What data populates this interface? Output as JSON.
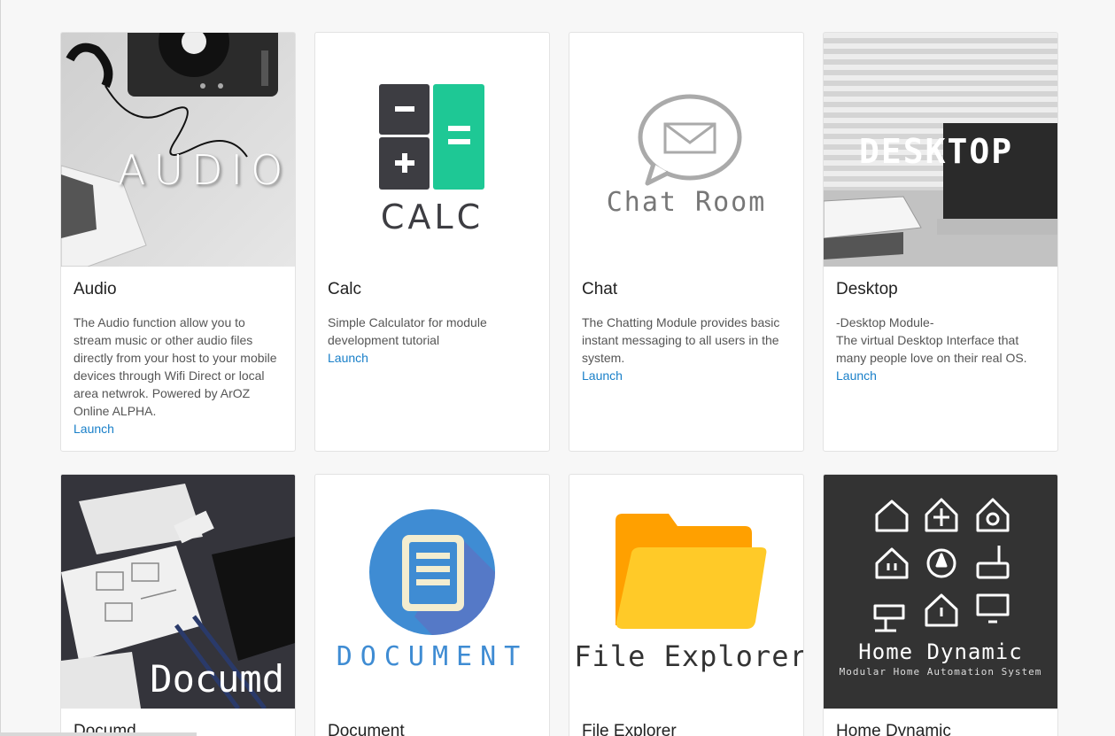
{
  "modules": [
    {
      "title": "Audio",
      "description": "The Audio function allow you to stream music or other audio files directly from your host to your mobile devices through Wifi Direct or local area netwrok. Powered by ArOZ Online ALPHA.",
      "launch": "Launch",
      "thumb_text": "AUDIO"
    },
    {
      "title": "Calc",
      "description": "Simple Calculator for module development tutorial",
      "launch": "Launch",
      "thumb_text": "CALC"
    },
    {
      "title": "Chat",
      "description": "The Chatting Module provides basic instant messaging to all users in the system.",
      "launch": "Launch",
      "thumb_text": "Chat Room"
    },
    {
      "title": "Desktop",
      "description": "-Desktop Module-\nThe virtual Desktop Interface that many people love on their real OS.",
      "launch": "Launch",
      "thumb_text": "DESKTOP"
    },
    {
      "title": "Documd",
      "thumb_text": "Documd"
    },
    {
      "title": "Document",
      "thumb_text": "DOCUMENT"
    },
    {
      "title": "File Explorer",
      "thumb_text": "File Explorer"
    },
    {
      "title": "Home Dynamic",
      "thumb_text": "Home Dynamic",
      "thumb_subtext": "Modular Home Automation System"
    }
  ],
  "colors": {
    "link": "#1a80c9",
    "calc_green": "#1ec895",
    "calc_dark": "#3d3d42",
    "doc_blue": "#3f8cd3",
    "folder_orange": "#ffa000",
    "folder_yellow": "#ffca28",
    "home_bg": "#333333"
  }
}
